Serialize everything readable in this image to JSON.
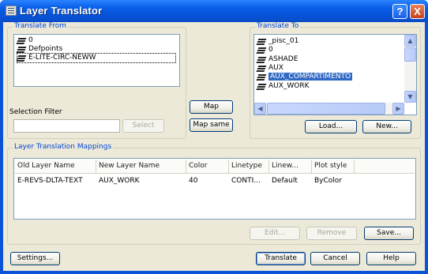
{
  "window": {
    "title": "Layer Translator",
    "help_label": "?",
    "close_label": "X"
  },
  "translate_from": {
    "group_label": "Translate From",
    "layers": [
      "0",
      "Defpoints",
      "E-LITE-CIRC-NEWW"
    ],
    "focused_item": "E-LITE-CIRC-NEWW",
    "selection_filter_label": "Selection Filter",
    "selection_filter_value": "",
    "select_label": "Select"
  },
  "middle": {
    "map_label": "Map",
    "map_same_label": "Map same"
  },
  "translate_to": {
    "group_label": "Translate To",
    "layers": [
      "_pisc_01",
      "0",
      "ASHADE",
      "AUX",
      "AUX_COMPARTIMENTO",
      "AUX_WORK"
    ],
    "selected_item": "AUX_COMPARTIMENTO",
    "load_label": "Load...",
    "new_label": "New..."
  },
  "mappings": {
    "group_label": "Layer Translation Mappings",
    "columns": [
      "Old Layer Name",
      "New Layer Name",
      "Color",
      "Linetype",
      "Linew...",
      "Plot style"
    ],
    "rows": [
      [
        "E-REVS-DLTA-TEXT",
        "AUX_WORK",
        "40",
        "CONTI...",
        "Default",
        "ByColor"
      ]
    ],
    "edit_label": "Edit...",
    "remove_label": "Remove",
    "save_label": "Save..."
  },
  "footer": {
    "settings_label": "Settings...",
    "translate_label": "Translate",
    "cancel_label": "Cancel",
    "help_label": "Help"
  },
  "colors": {
    "titlebar": "#0a5fe8",
    "face": "#ece9d8",
    "group_label": "#0046d5",
    "selection": "#316ac5"
  }
}
